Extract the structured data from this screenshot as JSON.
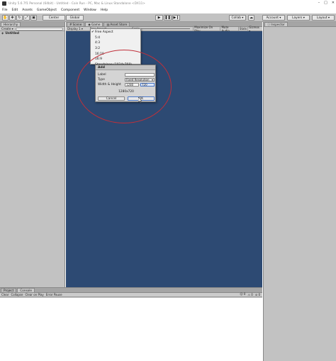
{
  "window": {
    "title": "Unity 5.6.7f1 Personal (64bit) - Untitled - Coin Run - PC, Mac & Linux Standalone <DX11>",
    "controls": [
      "–",
      "□",
      "✕"
    ]
  },
  "menubar": {
    "items": [
      "File",
      "Edit",
      "Assets",
      "GameObject",
      "Component",
      "Window",
      "Help"
    ]
  },
  "toolbar": {
    "pivot_label": "Center",
    "space_label": "Global",
    "collab_label": "Collab ▾",
    "account_label": "Account ▾",
    "layers_label": "Layers ▾",
    "layout_label": "Layout ▾"
  },
  "hierarchy": {
    "tab_label": "Hierarchy",
    "create_label": "Create ▾",
    "scene_label": "Untitled"
  },
  "game": {
    "tabs": [
      "Scene",
      "Game",
      "Asset Store"
    ],
    "display_label": "Display 1 ▾",
    "aspect_label": "Free Aspect ▾",
    "scale_label": "Scale",
    "options": [
      "Maximize On Play",
      "Mute Audio",
      "Stats",
      "Gizmos ▾"
    ]
  },
  "inspector": {
    "tab_label": "Inspector"
  },
  "console": {
    "tabs": [
      "Project",
      "Console"
    ],
    "buttons": [
      "Clear",
      "Collapse",
      "Clear on Play",
      "Error Pause"
    ]
  },
  "aspect_dropdown": {
    "items": [
      "Free Aspect",
      "5:4",
      "4:3",
      "3:2",
      "16:10",
      "16:9",
      "Standalone (1024x768)"
    ],
    "selected_index": 0
  },
  "add_dialog": {
    "title": "Add",
    "label_label": "Label",
    "label_value": "",
    "type_label": "Type",
    "type_value": "Fixed Resolution",
    "wh_label": "Width & Height",
    "width_value": "1280",
    "height_value": "720",
    "preview": "1280x720",
    "cancel_label": "Cancel",
    "ok_label": "OK"
  },
  "colors": {
    "viewport": "#2d4a73",
    "annotation": "#c0303a"
  }
}
